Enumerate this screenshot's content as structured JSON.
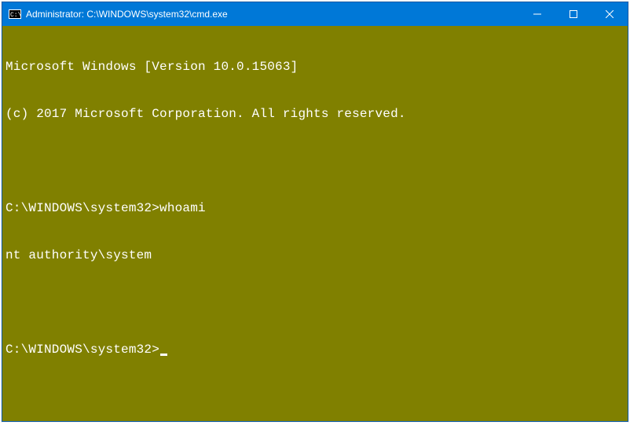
{
  "window": {
    "title": "Administrator: C:\\WINDOWS\\system32\\cmd.exe"
  },
  "terminal": {
    "banner_line1": "Microsoft Windows [Version 10.0.15063]",
    "banner_line2": "(c) 2017 Microsoft Corporation. All rights reserved.",
    "blank1": "",
    "session": {
      "prompt1": "C:\\WINDOWS\\system32>",
      "command1": "whoami",
      "output1": "nt authority\\system",
      "blank2": "",
      "prompt2": "C:\\WINDOWS\\system32>",
      "command2": ""
    }
  },
  "colors": {
    "titlebar_bg": "#0078d7",
    "titlebar_fg": "#ffffff",
    "terminal_bg": "#808000",
    "terminal_fg": "#ffffff"
  }
}
